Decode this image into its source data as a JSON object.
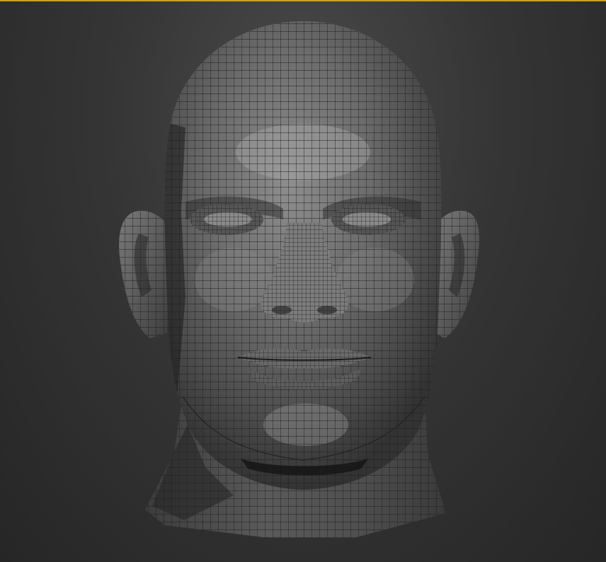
{
  "viewport": {
    "background_top": "#4a4a4a",
    "background_bottom": "#262626",
    "active_border_color": "#c9a227"
  },
  "model": {
    "display_mode": "shaded-wireframe",
    "shade_light": "#9a9a9a",
    "shade_mid": "#6a6a6a",
    "shade_dark": "#3a3a3a",
    "wire_color": "#1e1e1e"
  }
}
